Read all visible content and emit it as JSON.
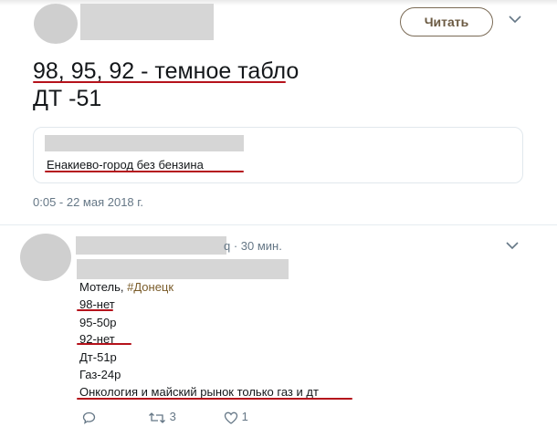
{
  "main_tweet": {
    "read_label": "Читать",
    "line1": "98, 95, 92 - темное табло",
    "line2": "ДТ -51",
    "quote_text": "Енакиево-город без бензина",
    "timestamp": "0:05 - 22 мая 2018 г."
  },
  "reply_tweet": {
    "time_suffix": "q · 30 мин.",
    "lines": [
      {
        "text": "Мотель, ",
        "hashtag": "#Донецк"
      },
      {
        "text": "98-нет"
      },
      {
        "text": "95-50р"
      },
      {
        "text": "92-нет"
      },
      {
        "text": "Дт-51р"
      },
      {
        "text": "Газ-24р"
      },
      {
        "text": "Онкология и майский рынок только газ и дт"
      }
    ],
    "actions": {
      "retweet_count": "3",
      "like_count": "1"
    }
  },
  "colors": {
    "underline": "#b5121b",
    "hashtag": "#7a5c2a",
    "muted": "#657786"
  }
}
